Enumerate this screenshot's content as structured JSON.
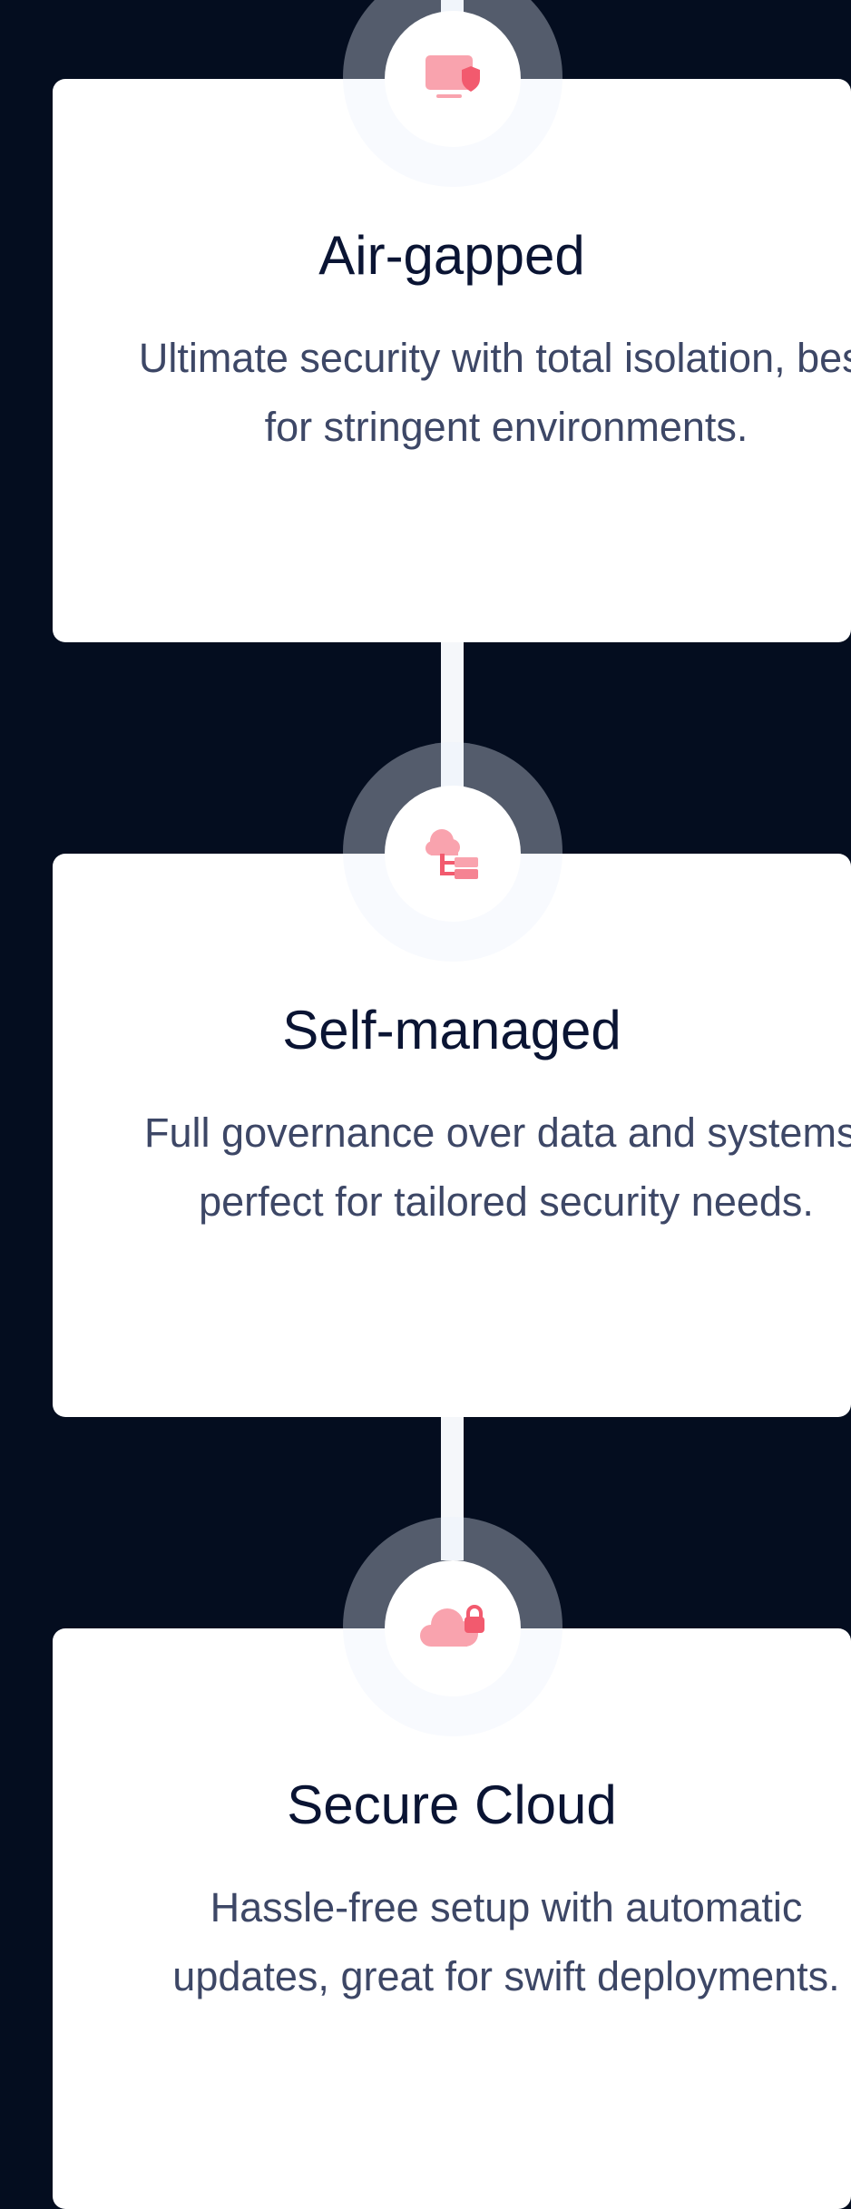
{
  "colors": {
    "background": "#040d1f",
    "card": "#ffffff",
    "accent": "#f25a6e",
    "accent_light": "#f9a3ae",
    "title": "#0a1433",
    "text": "#3d4766"
  },
  "options": [
    {
      "icon": "monitor-shield-icon",
      "title": "Air-gapped",
      "description": "Ultimate security with total isolation, best for stringent environments."
    },
    {
      "icon": "cloud-network-icon",
      "title": "Self-managed",
      "description": "Full governance over data and systems, perfect for tailored security needs."
    },
    {
      "icon": "cloud-lock-icon",
      "title": "Secure Cloud",
      "description": "Hassle-free setup with automatic updates, great for swift deployments."
    }
  ]
}
